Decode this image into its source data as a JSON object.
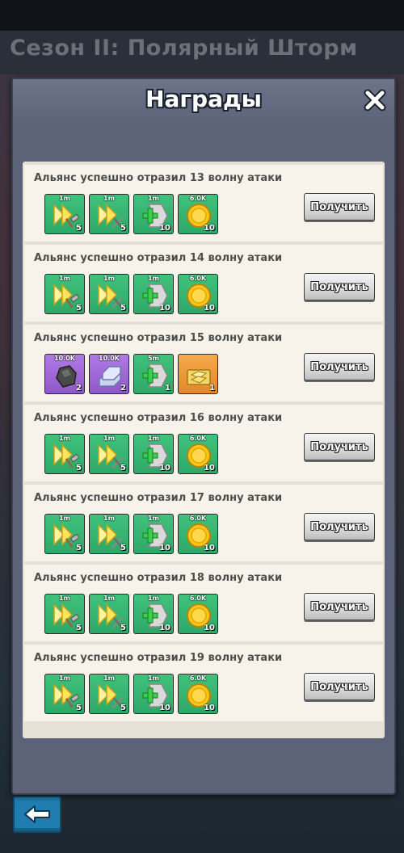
{
  "season": {
    "title": "Сезон II: Полярный Шторм"
  },
  "modal": {
    "title": "Награды"
  },
  "claim_label": "Получить",
  "rewards": [
    {
      "title": "Альянс успешно отразил 13 волну атаки",
      "items": [
        {
          "icon": "speedup-build-icon",
          "label": "1m",
          "count": "5",
          "bg": "green"
        },
        {
          "icon": "speedup-train-icon",
          "label": "1m",
          "count": "5",
          "bg": "green"
        },
        {
          "icon": "speedup-heal-icon",
          "label": "1m",
          "count": "10",
          "bg": "green"
        },
        {
          "icon": "gold-coin-icon",
          "label": "6.0K",
          "count": "10",
          "bg": "green"
        }
      ]
    },
    {
      "title": "Альянс успешно отразил 14 волну атаки",
      "items": [
        {
          "icon": "speedup-build-icon",
          "label": "1m",
          "count": "5",
          "bg": "green"
        },
        {
          "icon": "speedup-train-icon",
          "label": "1m",
          "count": "5",
          "bg": "green"
        },
        {
          "icon": "speedup-heal-icon",
          "label": "1m",
          "count": "10",
          "bg": "green"
        },
        {
          "icon": "gold-coin-icon",
          "label": "6.0K",
          "count": "10",
          "bg": "green"
        }
      ]
    },
    {
      "title": "Альянс успешно отразил 15 волну атаки",
      "items": [
        {
          "icon": "coal-ore-icon",
          "label": "10.0K",
          "count": "2",
          "bg": "purple"
        },
        {
          "icon": "iron-ingot-icon",
          "label": "10.0K",
          "count": "2",
          "bg": "purple"
        },
        {
          "icon": "speedup-heal-icon",
          "label": "5m",
          "count": "1",
          "bg": "green"
        },
        {
          "icon": "gold-bars-chest-icon",
          "label": "",
          "count": "1",
          "bg": "orange"
        }
      ]
    },
    {
      "title": "Альянс успешно отразил 16 волну атаки",
      "items": [
        {
          "icon": "speedup-build-icon",
          "label": "1m",
          "count": "5",
          "bg": "green"
        },
        {
          "icon": "speedup-train-icon",
          "label": "1m",
          "count": "5",
          "bg": "green"
        },
        {
          "icon": "speedup-heal-icon",
          "label": "1m",
          "count": "10",
          "bg": "green"
        },
        {
          "icon": "gold-coin-icon",
          "label": "6.0K",
          "count": "10",
          "bg": "green"
        }
      ]
    },
    {
      "title": "Альянс успешно отразил 17 волну атаки",
      "items": [
        {
          "icon": "speedup-build-icon",
          "label": "1m",
          "count": "5",
          "bg": "green"
        },
        {
          "icon": "speedup-train-icon",
          "label": "1m",
          "count": "5",
          "bg": "green"
        },
        {
          "icon": "speedup-heal-icon",
          "label": "1m",
          "count": "10",
          "bg": "green"
        },
        {
          "icon": "gold-coin-icon",
          "label": "6.0K",
          "count": "10",
          "bg": "green"
        }
      ]
    },
    {
      "title": "Альянс успешно отразил 18 волну атаки",
      "items": [
        {
          "icon": "speedup-build-icon",
          "label": "1m",
          "count": "5",
          "bg": "green"
        },
        {
          "icon": "speedup-train-icon",
          "label": "1m",
          "count": "5",
          "bg": "green"
        },
        {
          "icon": "speedup-heal-icon",
          "label": "1m",
          "count": "10",
          "bg": "green"
        },
        {
          "icon": "gold-coin-icon",
          "label": "6.0K",
          "count": "10",
          "bg": "green"
        }
      ]
    },
    {
      "title": "Альянс успешно отразил 19 волну атаки",
      "items": [
        {
          "icon": "speedup-build-icon",
          "label": "1m",
          "count": "5",
          "bg": "green"
        },
        {
          "icon": "speedup-train-icon",
          "label": "1m",
          "count": "5",
          "bg": "green"
        },
        {
          "icon": "speedup-heal-icon",
          "label": "1m",
          "count": "10",
          "bg": "green"
        },
        {
          "icon": "gold-coin-icon",
          "label": "6.0K",
          "count": "10",
          "bg": "green"
        }
      ]
    }
  ]
}
